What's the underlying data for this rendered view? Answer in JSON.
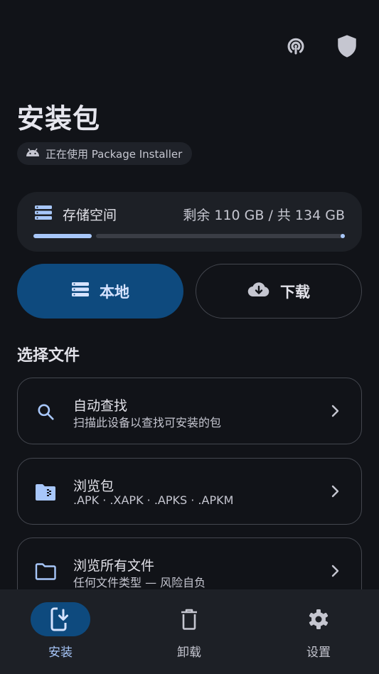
{
  "header": {
    "title": "安装包",
    "installer_chip": "正在使用 Package Installer",
    "icons": [
      "broadcast-icon",
      "shield-icon"
    ]
  },
  "storage": {
    "label": "存储空间",
    "value": "剩余 110 GB / 共 134 GB",
    "used_fraction": 0.18
  },
  "source_tabs": {
    "local": "本地",
    "download": "下载",
    "selected": "local"
  },
  "files": {
    "section_title": "选择文件",
    "items": [
      {
        "title": "自动查找",
        "subtitle": "扫描此设备以查找可安装的包",
        "icon": "search-icon"
      },
      {
        "title": "浏览包",
        "subtitle": ".APK · .XAPK · .APKS · .APKM",
        "icon": "package-folder-icon"
      },
      {
        "title": "浏览所有文件",
        "subtitle": "任何文件类型 — 风险自负",
        "icon": "folder-icon"
      }
    ]
  },
  "nav": {
    "items": [
      {
        "label": "安装",
        "icon": "install-icon",
        "active": true
      },
      {
        "label": "卸载",
        "icon": "trash-icon",
        "active": false
      },
      {
        "label": "设置",
        "icon": "gear-icon",
        "active": false
      }
    ]
  },
  "colors": {
    "background": "#111318",
    "accent": "#a8c7fa",
    "accent_container": "#0e4a7e",
    "outline": "#44474f"
  }
}
